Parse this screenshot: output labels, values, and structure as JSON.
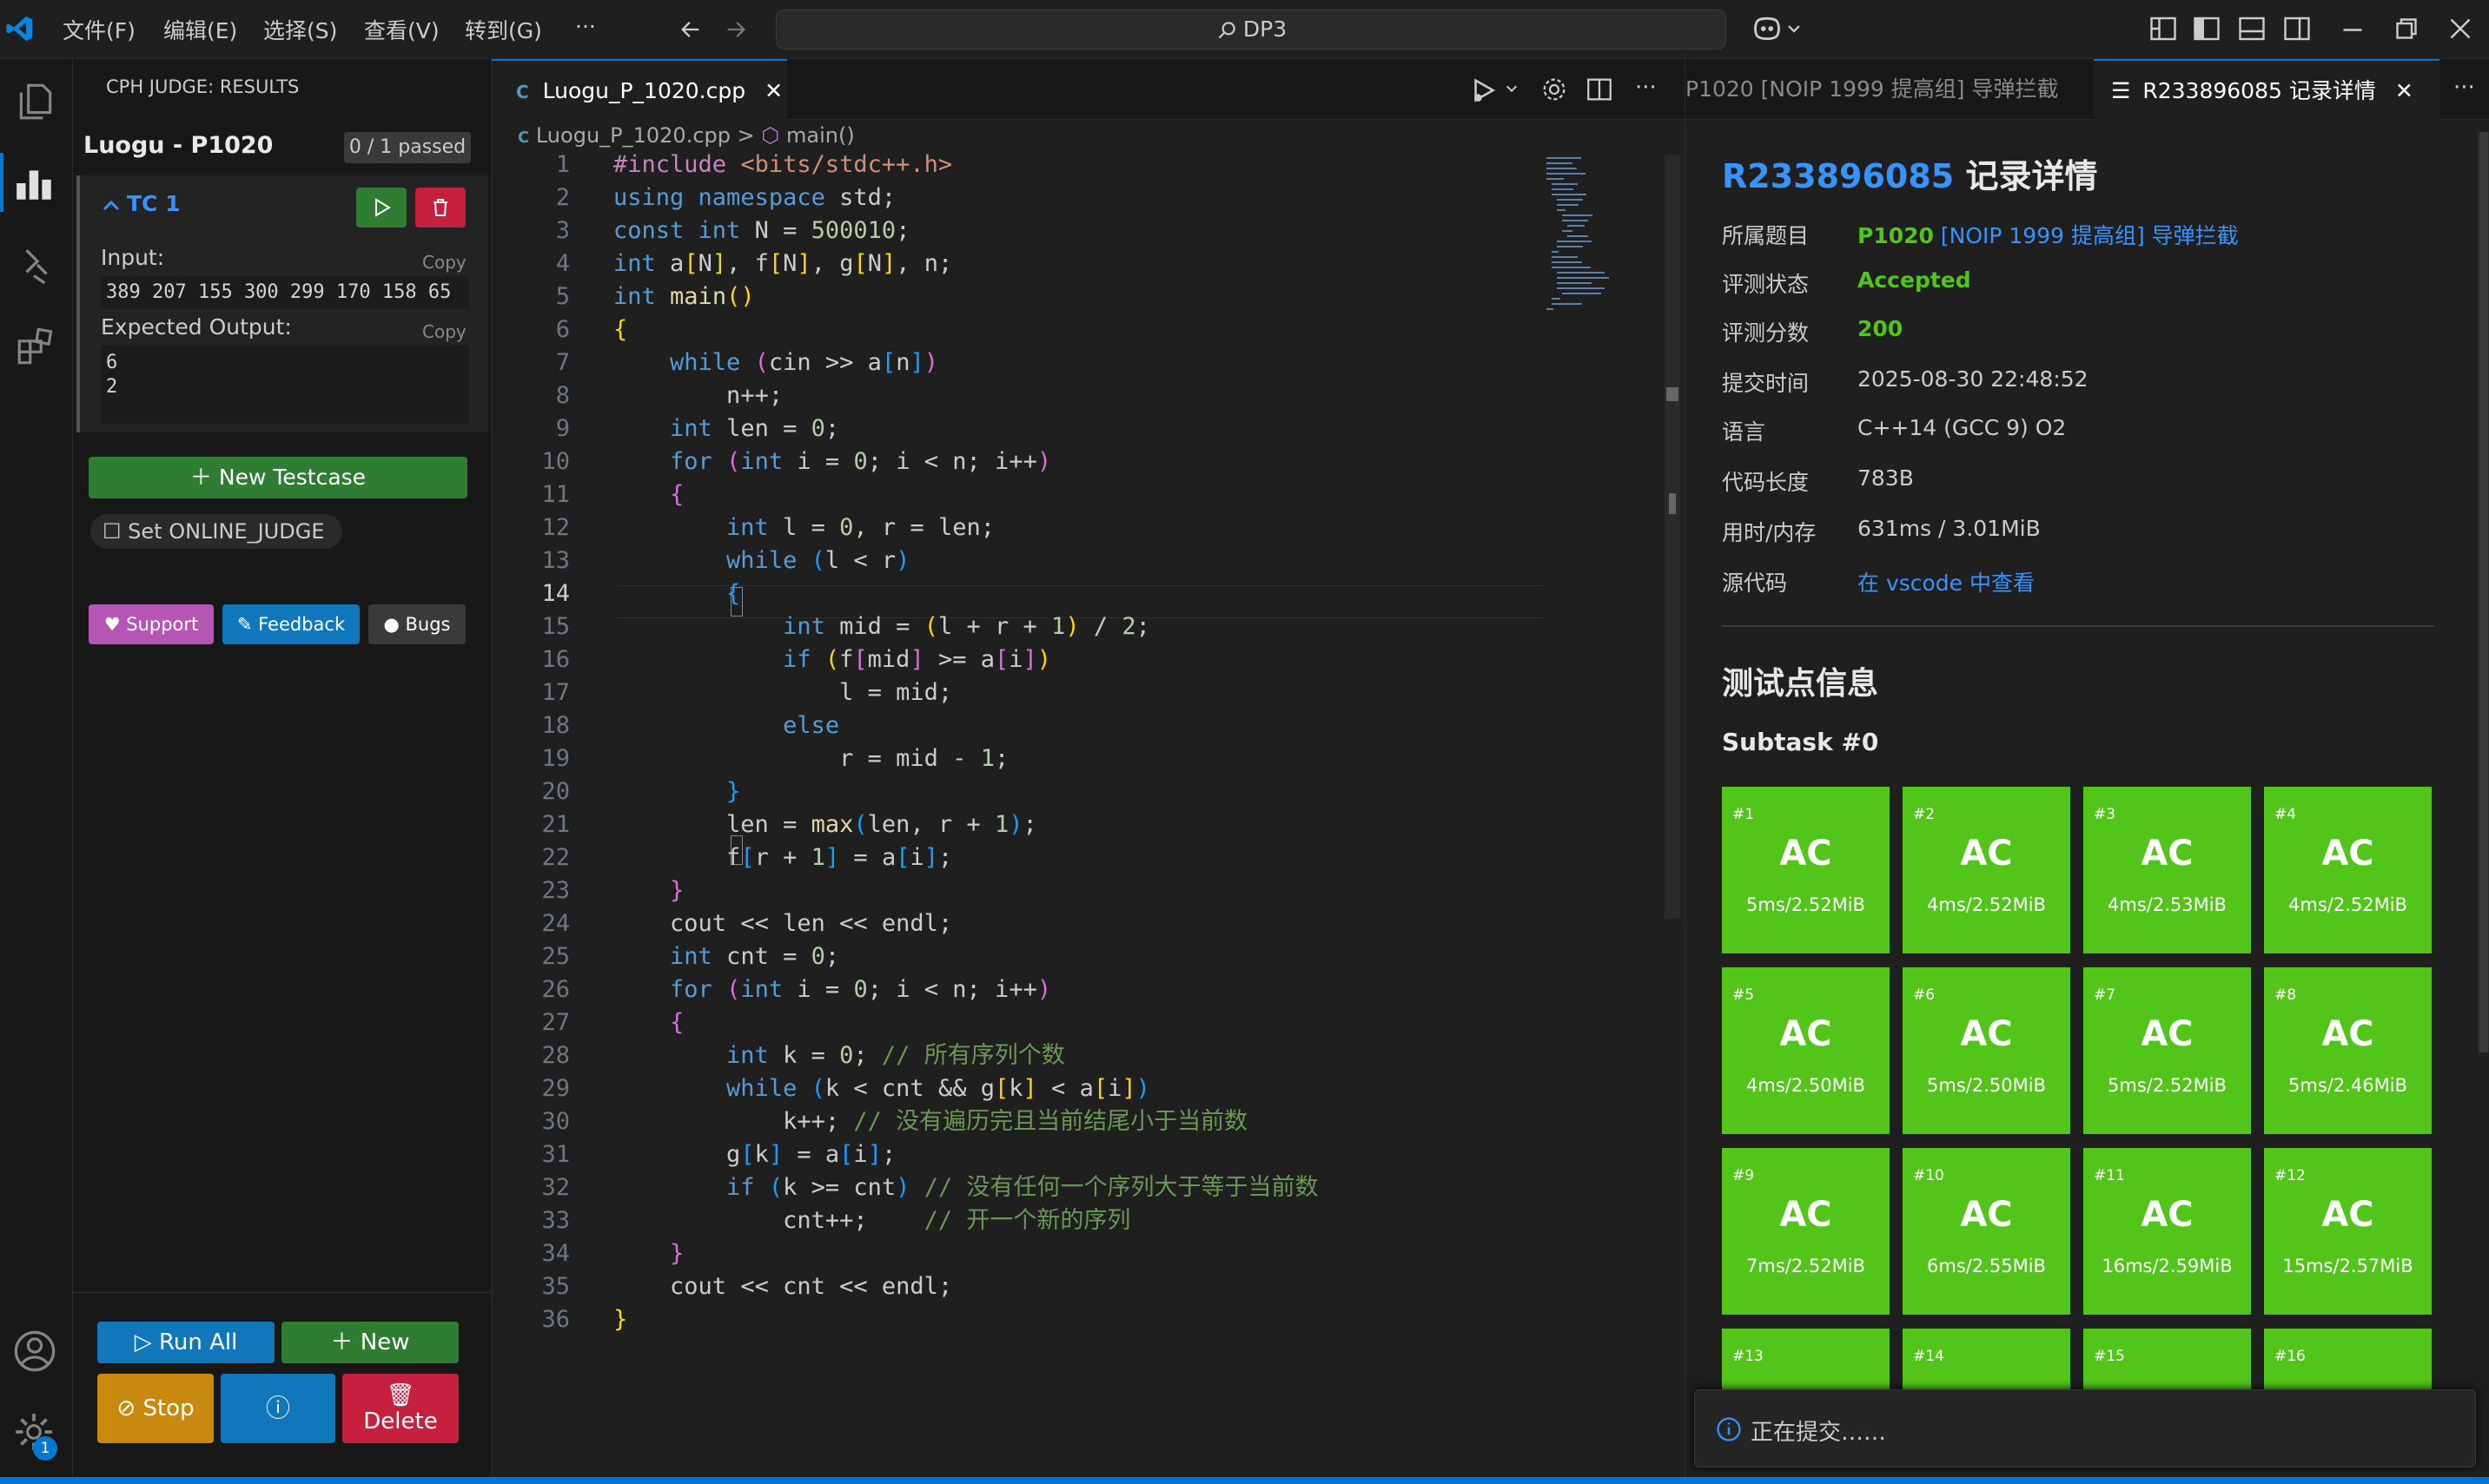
{
  "titlebar": {
    "menu": [
      "文件(F)",
      "编辑(E)",
      "选择(S)",
      "查看(V)",
      "转到(G)",
      "···"
    ],
    "search": "DP3"
  },
  "cph": {
    "header": "CPH JUDGE: RESULTS",
    "problem": "Luogu - P1020",
    "passed": "0 / 1 passed",
    "tc_label": "TC 1",
    "input_label": "Input:",
    "copy": "Copy",
    "input_value": "389 207 155 300 299 170 158 65",
    "expected_label": "Expected Output:",
    "expected_lines": [
      "6",
      "2"
    ],
    "new_testcase": "New Testcase",
    "online_judge": "Set ONLINE_JUDGE",
    "support": "Support",
    "feedback": "Feedback",
    "bugs": "Bugs",
    "run_all": "Run All",
    "new": "New",
    "stop": "Stop",
    "delete": "Delete"
  },
  "editor": {
    "tab": "Luogu_P_1020.cpp",
    "breadcrumb_file": "Luogu_P_1020.cpp",
    "breadcrumb_sep": ">",
    "breadcrumb_symbol": "main()"
  },
  "right": {
    "tab_inactive": "P1020 [NOIP 1999 提高组] 导弹拦截",
    "tab_active": "R233896085 记录详情",
    "record_id": "R233896085",
    "record_title": " 记录详情",
    "rows": [
      {
        "k": "所属题目",
        "v": "P1020",
        "v2": "[NOIP 1999 提高组] 导弹拦截"
      },
      {
        "k": "评测状态",
        "v": "Accepted"
      },
      {
        "k": "评测分数",
        "v": "200"
      },
      {
        "k": "提交时间",
        "v": "2025-08-30 22:48:52"
      },
      {
        "k": "语言",
        "v": "C++14 (GCC 9) O2"
      },
      {
        "k": "代码长度",
        "v": "783B"
      },
      {
        "k": "用时/内存",
        "v": "631ms / 3.01MiB"
      },
      {
        "k": "源代码",
        "v": "在 vscode 中查看"
      }
    ],
    "section": "测试点信息",
    "subtask": "Subtask #0",
    "tiles": [
      {
        "n": "#1",
        "r": "AC",
        "t": "5ms/2.52MiB"
      },
      {
        "n": "#2",
        "r": "AC",
        "t": "4ms/2.52MiB"
      },
      {
        "n": "#3",
        "r": "AC",
        "t": "4ms/2.53MiB"
      },
      {
        "n": "#4",
        "r": "AC",
        "t": "4ms/2.52MiB"
      },
      {
        "n": "#5",
        "r": "AC",
        "t": "4ms/2.50MiB"
      },
      {
        "n": "#6",
        "r": "AC",
        "t": "5ms/2.50MiB"
      },
      {
        "n": "#7",
        "r": "AC",
        "t": "5ms/2.52MiB"
      },
      {
        "n": "#8",
        "r": "AC",
        "t": "5ms/2.46MiB"
      },
      {
        "n": "#9",
        "r": "AC",
        "t": "7ms/2.52MiB"
      },
      {
        "n": "#10",
        "r": "AC",
        "t": "6ms/2.55MiB"
      },
      {
        "n": "#11",
        "r": "AC",
        "t": "16ms/2.59MiB"
      },
      {
        "n": "#12",
        "r": "AC",
        "t": "15ms/2.57MiB"
      },
      {
        "n": "#13",
        "r": "",
        "t": ""
      },
      {
        "n": "#14",
        "r": "",
        "t": ""
      },
      {
        "n": "#15",
        "r": "",
        "t": ""
      },
      {
        "n": "#16",
        "r": "",
        "t": ""
      }
    ],
    "toast": "正在提交……"
  },
  "badge": "1",
  "colors": {
    "accent": "#0078d4",
    "ac": "#52c41a",
    "green_btn": "#2e7d32",
    "red_btn": "#c5203d",
    "blue_btn": "#1177bb",
    "orange_btn": "#c9880e"
  }
}
